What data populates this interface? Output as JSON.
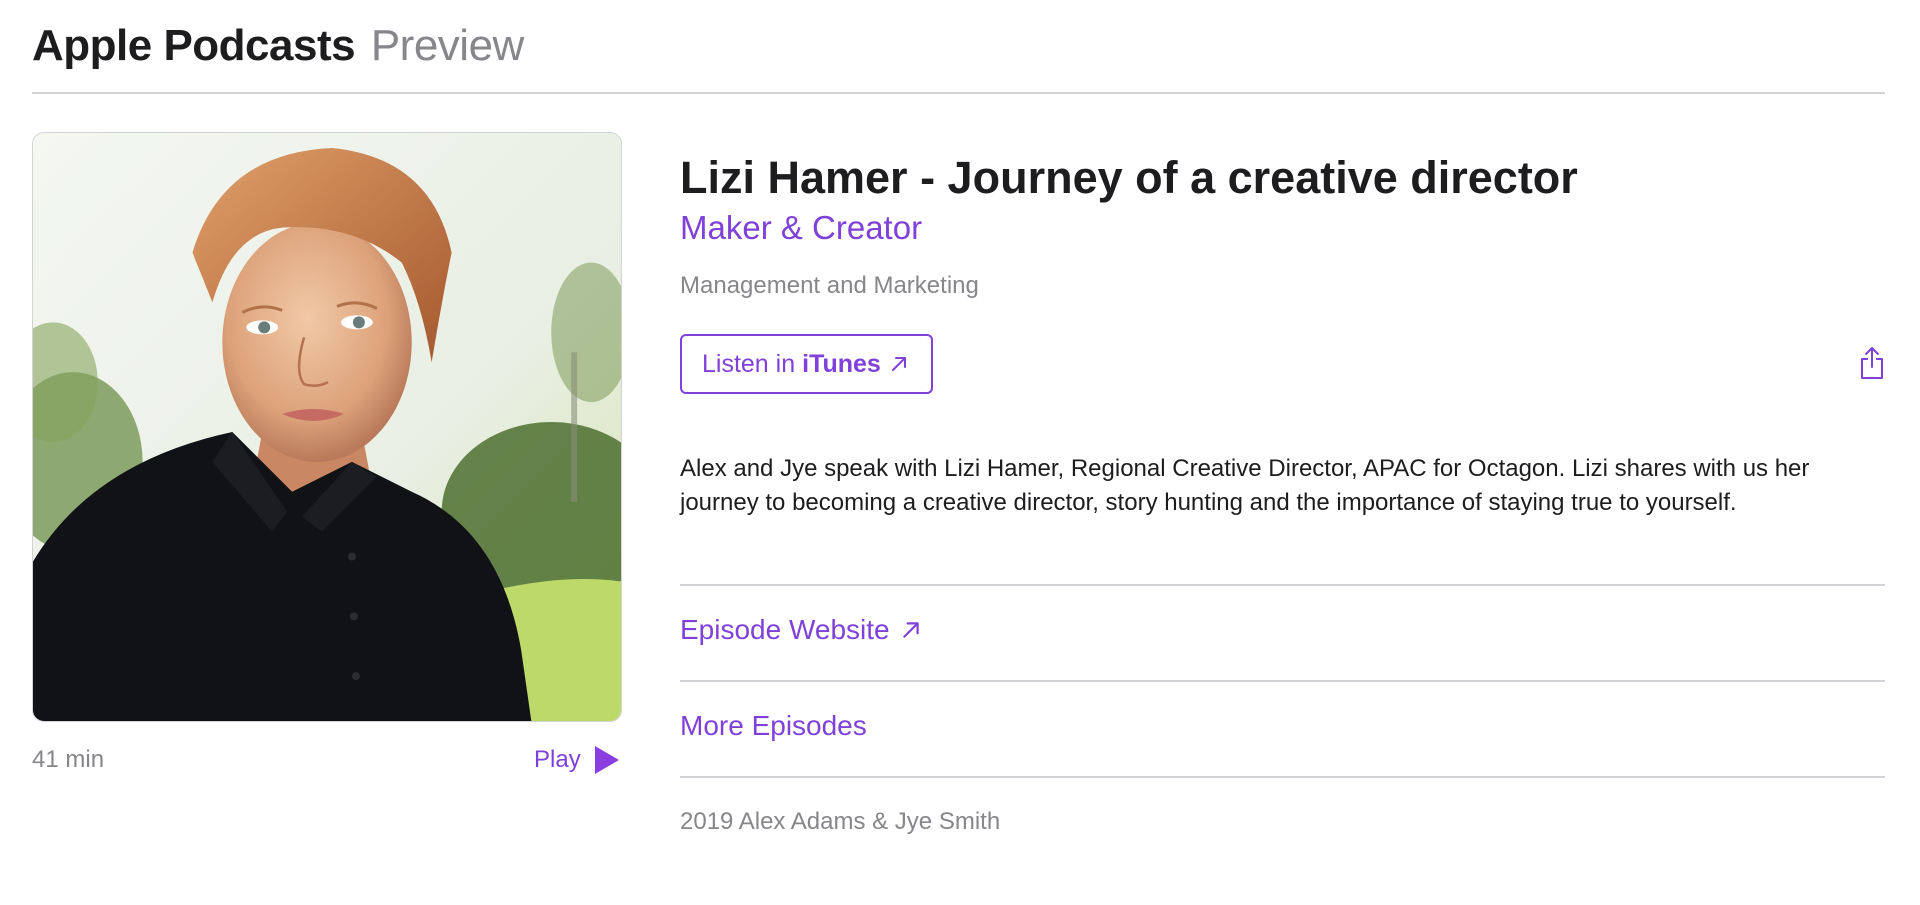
{
  "header": {
    "brand": "Apple Podcasts",
    "sub": "Preview"
  },
  "episode": {
    "duration": "41 min",
    "play_label": "Play",
    "title": "Lizi Hamer - Journey of a creative director",
    "show": "Maker & Creator",
    "category": "Management and Marketing",
    "listen_prefix": "Listen in",
    "listen_app": "iTunes",
    "description": "Alex and Jye speak with Lizi Hamer, Regional Creative Director, APAC for Octagon.  Lizi shares with us her journey to becoming a creative director, story hunting and the importance of staying true to yourself.",
    "website_link": "Episode Website",
    "more_link": "More Episodes",
    "copyright": "2019 Alex Adams & Jye Smith"
  },
  "icons": {
    "play": "play-icon",
    "share": "share-icon",
    "external": "external-arrow-icon"
  },
  "colors": {
    "accent": "#7f41d9",
    "secondary_text": "#86868b",
    "divider": "#d2d2d7"
  }
}
